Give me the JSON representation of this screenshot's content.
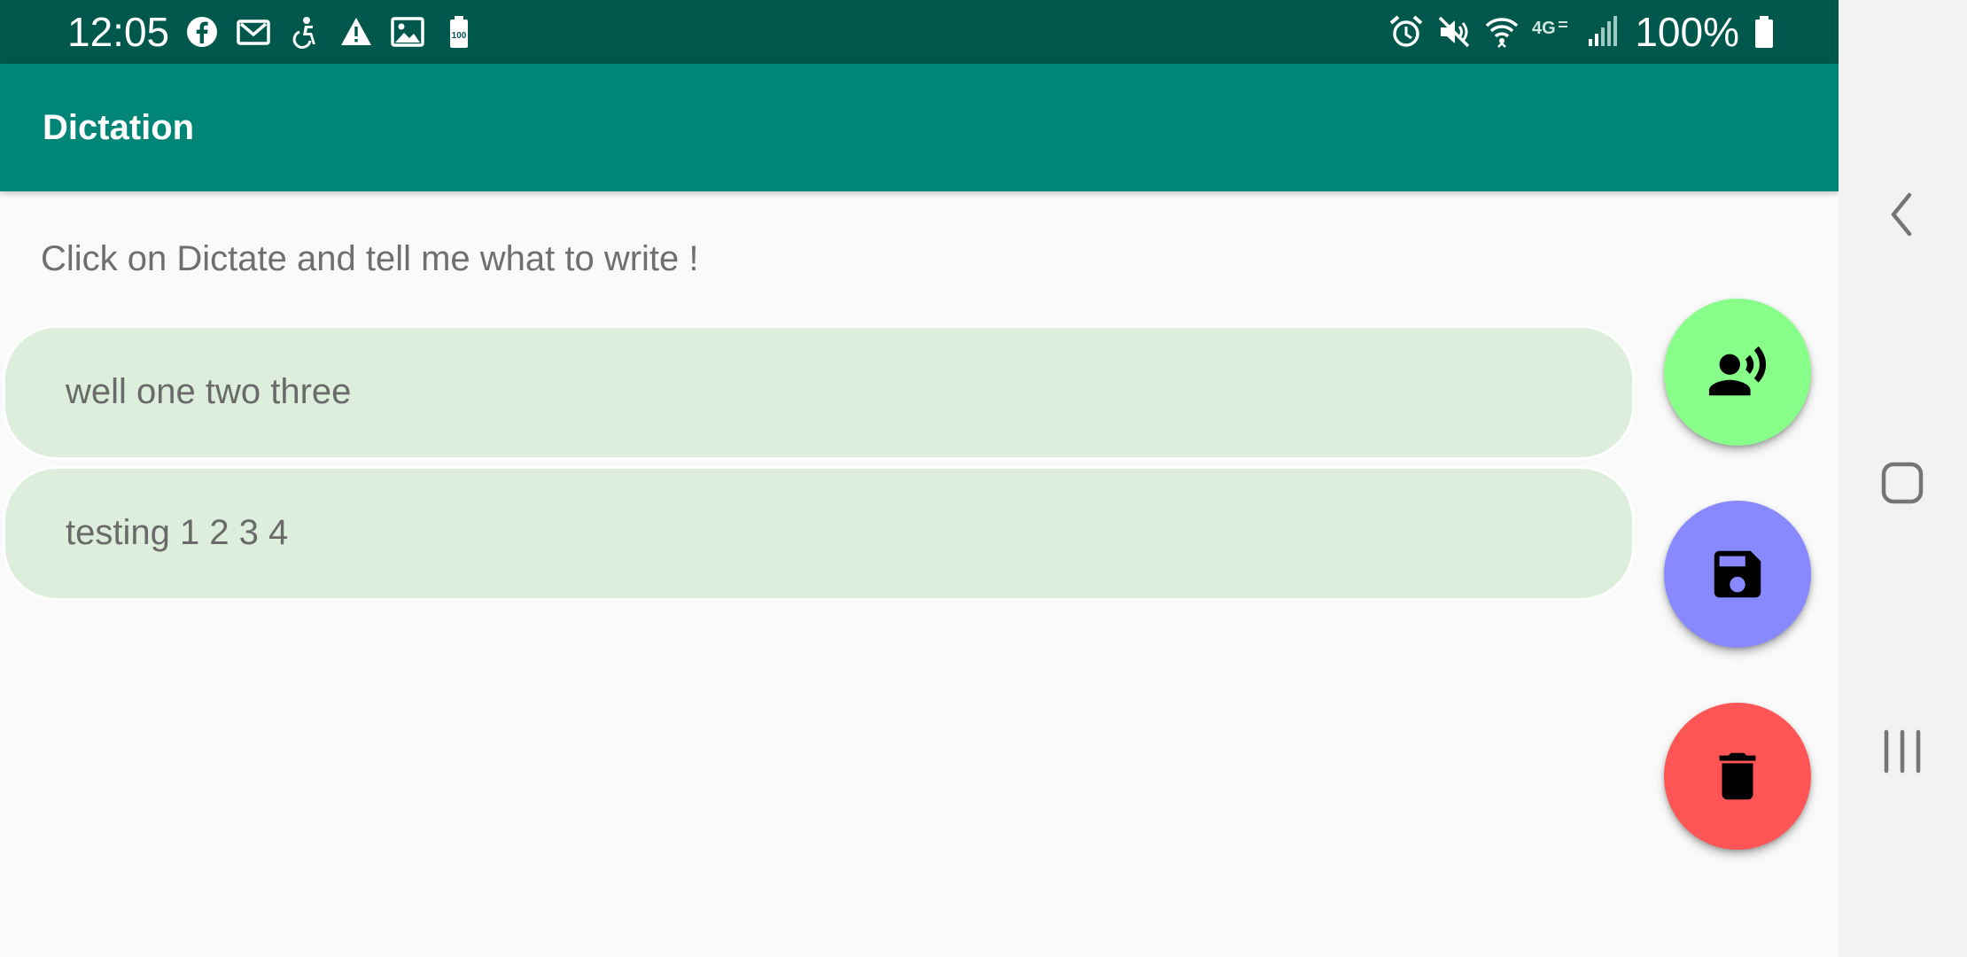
{
  "status_bar": {
    "time": "12:05",
    "battery_text": "100%",
    "battery_badge": "100",
    "left_icons": [
      "facebook-icon",
      "gmail-icon",
      "accessibility-icon",
      "warning-icon",
      "image-icon",
      "battery-saver-icon"
    ],
    "right_icons": [
      "alarm-icon",
      "mute-icon",
      "wifi-icon",
      "lte-icon",
      "signal-icon",
      "battery-icon"
    ],
    "lte_label": "4G"
  },
  "app_bar": {
    "title": "Dictation"
  },
  "main": {
    "instruction": "Click on Dictate and tell me what to write !",
    "entries": [
      {
        "text": "well one two three"
      },
      {
        "text": "testing 1 2 3 4"
      }
    ]
  },
  "fabs": [
    {
      "icon": "record-voice-icon",
      "color": "#88ff88"
    },
    {
      "icon": "save-icon",
      "color": "#8888ff"
    },
    {
      "icon": "delete-icon",
      "color": "#ff5555"
    }
  ],
  "nav_bar": {
    "buttons": [
      "back-icon",
      "home-icon",
      "recent-apps-icon"
    ]
  },
  "colors": {
    "status_bar": "#00574b",
    "app_bar": "#008577",
    "entry_background": "#ddefdc",
    "background": "#fafafa"
  }
}
